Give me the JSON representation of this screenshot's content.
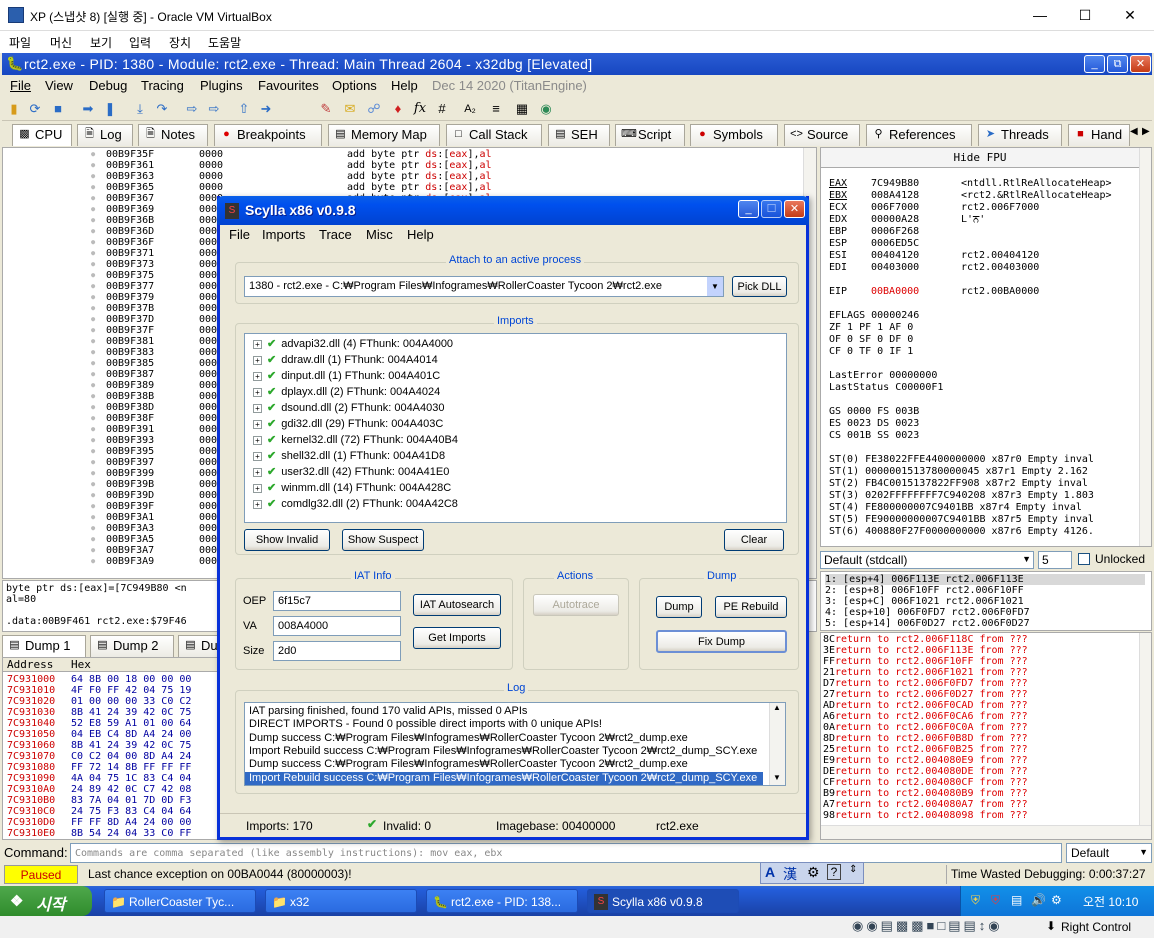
{
  "vbox": {
    "title": "XP (스냅샷 8) [실행 중] - Oracle VM VirtualBox",
    "menu": [
      "파일",
      "머신",
      "보기",
      "입력",
      "장치",
      "도움말"
    ],
    "status_host": "Right Control"
  },
  "xdbg": {
    "title": "rct2.exe - PID: 1380 - Module: rct2.exe - Thread: Main Thread 2604 - x32dbg [Elevated]",
    "menu": [
      "File",
      "View",
      "Debug",
      "Tracing",
      "Plugins",
      "Favourites",
      "Options",
      "Help"
    ],
    "build": "Dec 14 2020 (TitanEngine)",
    "tabs": [
      "CPU",
      "Log",
      "Notes",
      "Breakpoints",
      "Memory Map",
      "Call Stack",
      "SEH",
      "Script",
      "Symbols",
      "Source",
      "References",
      "Threads",
      "Hand"
    ],
    "disasm_addrs": [
      "00B9F35F",
      "00B9F361",
      "00B9F363",
      "00B9F365",
      "00B9F367",
      "00B9F369",
      "00B9F36B",
      "00B9F36D",
      "00B9F36F",
      "00B9F371",
      "00B9F373",
      "00B9F375",
      "00B9F377",
      "00B9F379",
      "00B9F37B",
      "00B9F37D",
      "00B9F37F",
      "00B9F381",
      "00B9F383",
      "00B9F385",
      "00B9F387",
      "00B9F389",
      "00B9F38B",
      "00B9F38D",
      "00B9F38F",
      "00B9F391",
      "00B9F393",
      "00B9F395",
      "00B9F397",
      "00B9F399",
      "00B9F39B",
      "00B9F39D",
      "00B9F39F",
      "00B9F3A1",
      "00B9F3A3",
      "00B9F3A5",
      "00B9F3A7",
      "00B9F3A9"
    ],
    "disasm_bytes": "0000",
    "disasm_instr": "add byte ptr ds:[eax],al",
    "info_line1": "byte ptr ds:[eax]=[7C949B80 <n",
    "info_line2": "al=80",
    "info_line3": ".data:00B9F461 rct2.exe:$79F46",
    "hide_fpu": "Hide FPU",
    "registers": [
      {
        "n": "EAX",
        "v": "7C949B80",
        "c": "<ntdll.RtlReAllocateHeap>"
      },
      {
        "n": "EBX",
        "v": "008A4128",
        "c": "<rct2.&RtlReAllocateHeap>"
      },
      {
        "n": "ECX",
        "v": "006F7000",
        "c": "rct2.006F7000"
      },
      {
        "n": "EDX",
        "v": "00000A28",
        "c": "L'ਨ'"
      },
      {
        "n": "EBP",
        "v": "0006F268",
        "c": ""
      },
      {
        "n": "ESP",
        "v": "0006ED5C",
        "c": ""
      },
      {
        "n": "ESI",
        "v": "00404120",
        "c": "rct2.00404120"
      },
      {
        "n": "EDI",
        "v": "00403000",
        "c": "rct2.00403000"
      }
    ],
    "eip": {
      "n": "EIP",
      "v": "00BA0000",
      "c": "rct2.00BA0000"
    },
    "eflags": "EFLAGS   00000246",
    "flags": [
      "ZF 1  PF 1  AF 0",
      "OF 0  SF 0  DF 0",
      "CF 0  TF 0  IF 1"
    ],
    "lasterror": "LastError  00000000",
    "laststatus": "LastStatus C00000F1",
    "segs": [
      "GS 0000  FS 003B",
      "ES 0023  DS 0023",
      "CS 001B  SS 0023"
    ],
    "fpu": [
      "ST(0) FE38022FFE4400000000 x87r0 Empty inval",
      "ST(1) 0000001513780000045 x87r1 Empty 2.162",
      "ST(2) FB4C0015137822FF908 x87r2 Empty inval",
      "ST(3) 0202FFFFFFFF7C940208 x87r3 Empty 1.803",
      "ST(4) FE800000007C9401BB x87r4 Empty inval",
      "ST(5) FE90000000007C9401BB x87r5 Empty inval",
      "ST(6) 400880F27F0000000000 x87r6 Empty 4126."
    ],
    "callconv": "Default (stdcall)",
    "argcount": "5",
    "unlocked": "Unlocked",
    "stack": [
      "1: [esp+4]  006F113E rct2.006F113E",
      "2: [esp+8]  006F10FF rct2.006F10FF",
      "3: [esp+C]  006F1021 rct2.006F1021",
      "4: [esp+10] 006F0FD7 rct2.006F0FD7",
      "5: [esp+14] 006F0D27 rct2.006F0D27"
    ],
    "dump_tabs": [
      "Dump 1",
      "Dump 2",
      "Du"
    ],
    "dump_header": [
      "Address",
      "Hex"
    ],
    "dump_rows": [
      [
        "7C931000",
        "64 8B 00 18 00 00 00"
      ],
      [
        "7C931010",
        "4F F0 FF 42 04 75 19"
      ],
      [
        "7C931020",
        "01 00 00 00 33 C0 C2"
      ],
      [
        "7C931030",
        "8B 41 24 39 42 0C 75"
      ],
      [
        "7C931040",
        "52 E8 59 A1 01 00 64"
      ],
      [
        "7C931050",
        "04 EB C4 8D A4 24 00"
      ],
      [
        "7C931060",
        "8B 41 24 39 42 0C 75"
      ],
      [
        "7C931070",
        "C0 C2 04 00 8D A4 24"
      ],
      [
        "7C931080",
        "FF 72 14 8B FF FF FF"
      ],
      [
        "7C931090",
        "4A 04 75 1C 83 C4 04"
      ],
      [
        "7C9310A0",
        "24 89 42 0C C7 42 08"
      ],
      [
        "7C9310B0",
        "83 7A 04 01 7D 0D F3"
      ],
      [
        "7C9310C0",
        "24 75 F3 83 C4 04 64"
      ],
      [
        "7C9310D0",
        "FF FF 8D A4 24 00 00"
      ],
      [
        "7C9310E0",
        "8B 54 24 04 33 C0 FF"
      ]
    ],
    "callstack_left": [
      "8C",
      "3E",
      "FF",
      "21",
      "D7",
      "27",
      "AD",
      "A6",
      "0A",
      "8D",
      "25",
      "E9",
      "DE",
      "CF",
      "B9",
      "A7",
      "98"
    ],
    "callstack": [
      "return to rct2.006F118C from ???",
      "return to rct2.006F113E from ???",
      "return to rct2.006F10FF from ???",
      "return to rct2.006F1021 from ???",
      "return to rct2.006F0FD7 from ???",
      "return to rct2.006F0D27 from ???",
      "return to rct2.006F0CAD from ???",
      "return to rct2.006F0CA6 from ???",
      "return to rct2.006F0C0A from ???",
      "return to rct2.006F0B8D from ???",
      "return to rct2.006F0B25 from ???",
      "return to rct2.004080E9 from ???",
      "return to rct2.004080DE from ???",
      "return to rct2.004080CF from ???",
      "return to rct2.004080B9 from ???",
      "return to rct2.004080A7 from ???",
      "return to rct2.00408098 from ???"
    ],
    "command_label": "Command:",
    "command_placeholder": "Commands are comma separated (like assembly instructions): mov eax, ebx",
    "command_mode": "Default",
    "paused": "Paused",
    "exception": "Last chance exception on 00BA0044 (80000003)!",
    "time_wasted": "Time Wasted Debugging: 0:00:37:27"
  },
  "scylla": {
    "title": "Scylla x86 v0.9.8",
    "menu": [
      "File",
      "Imports",
      "Trace",
      "Misc",
      "Help"
    ],
    "attach_label": "Attach to an active process",
    "process": "1380 - rct2.exe - C:₩Program Files₩Infogrames₩RollerCoaster Tycoon 2₩rct2.exe",
    "pick_dll": "Pick DLL",
    "imports_label": "Imports",
    "imports": [
      "advapi32.dll (4) FThunk: 004A4000",
      "ddraw.dll (1) FThunk: 004A4014",
      "dinput.dll (1) FThunk: 004A401C",
      "dplayx.dll (2) FThunk: 004A4024",
      "dsound.dll (2) FThunk: 004A4030",
      "gdi32.dll (29) FThunk: 004A403C",
      "kernel32.dll (72) FThunk: 004A40B4",
      "shell32.dll (1) FThunk: 004A41D8",
      "user32.dll (42) FThunk: 004A41E0",
      "winmm.dll (14) FThunk: 004A428C",
      "comdlg32.dll (2) FThunk: 004A42C8"
    ],
    "show_invalid": "Show Invalid",
    "show_suspect": "Show Suspect",
    "clear": "Clear",
    "iat_label": "IAT Info",
    "oep_label": "OEP",
    "oep": "6f15c7",
    "va_label": "VA",
    "va": "008A4000",
    "size_label": "Size",
    "size": "2d0",
    "iat_autosearch": "IAT Autosearch",
    "get_imports": "Get Imports",
    "actions_label": "Actions",
    "autotrace": "Autotrace",
    "dump_label": "Dump",
    "dump": "Dump",
    "pe_rebuild": "PE Rebuild",
    "fix_dump": "Fix Dump",
    "log_label": "Log",
    "log": [
      "IAT parsing finished, found 170 valid APIs, missed 0 APIs",
      "DIRECT IMPORTS - Found 0 possible direct imports with 0 unique APIs!",
      "Dump success C:₩Program Files₩Infogrames₩RollerCoaster Tycoon 2₩rct2_dump.exe",
      "Import Rebuild success C:₩Program Files₩Infogrames₩RollerCoaster Tycoon 2₩rct2_dump_SCY.exe",
      "Dump success C:₩Program Files₩Infogrames₩RollerCoaster Tycoon 2₩rct2_dump.exe",
      "Import Rebuild success C:₩Program Files₩Infogrames₩RollerCoaster Tycoon 2₩rct2_dump_SCY.exe"
    ],
    "status_imports": "Imports: 170",
    "status_invalid": "Invalid: 0",
    "status_imagebase": "Imagebase: 00400000",
    "status_module": "rct2.exe"
  },
  "taskbar": {
    "start": "시작",
    "items": [
      "RollerCoaster Tyc...",
      "x32",
      "rct2.exe - PID: 138...",
      "Scylla x86 v0.9.8"
    ],
    "clock": "오전 10:10"
  },
  "ime": {
    "mode": "A",
    "hanja": "漢"
  }
}
